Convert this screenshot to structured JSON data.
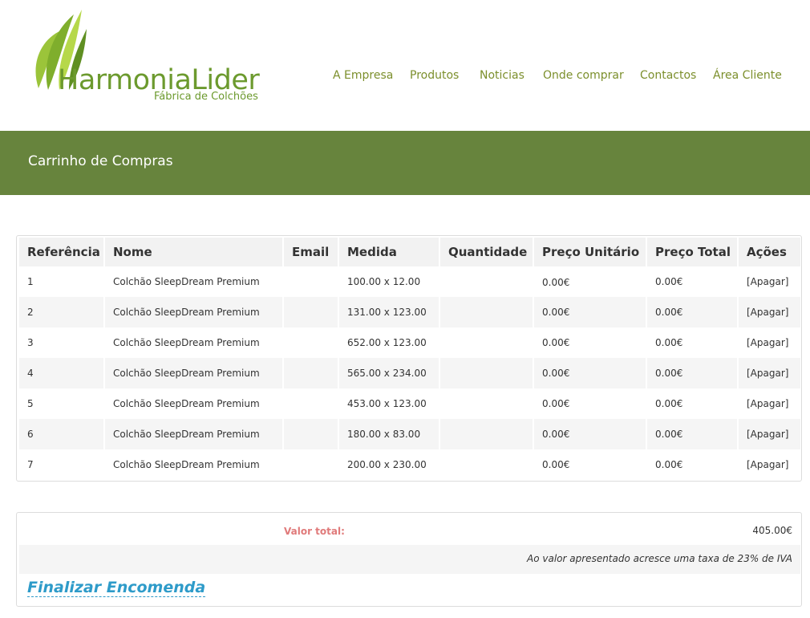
{
  "brand": {
    "name": "HarmoniaLider",
    "tagline": "Fábrica de Colchões",
    "color": "#6c9a2e"
  },
  "nav": [
    {
      "label": "A Empresa"
    },
    {
      "label": "Produtos"
    },
    {
      "label": "Noticias"
    },
    {
      "label": "Onde comprar"
    },
    {
      "label": "Contactos"
    },
    {
      "label": "Área Cliente"
    }
  ],
  "page": {
    "title": "Carrinho de Compras",
    "title_bar_color": "#67843d"
  },
  "cart": {
    "columns": [
      "Referência",
      "Nome",
      "Email",
      "Medida",
      "Quantidade",
      "Preço Unitário",
      "Preço Total",
      "Ações"
    ],
    "rows": [
      {
        "ref": "1",
        "nome": "Colchão SleepDream Premium",
        "email": "",
        "medida": "100.00 x 12.00",
        "quantidade": "",
        "preco_unit": "0.00€",
        "preco_total": "0.00€",
        "acao": "[Apagar]"
      },
      {
        "ref": "2",
        "nome": "Colchão SleepDream Premium",
        "email": "",
        "medida": "131.00 x 123.00",
        "quantidade": "",
        "preco_unit": "0.00€",
        "preco_total": "0.00€",
        "acao": "[Apagar]"
      },
      {
        "ref": "3",
        "nome": "Colchão SleepDream Premium",
        "email": "",
        "medida": "652.00 x 123.00",
        "quantidade": "",
        "preco_unit": "0.00€",
        "preco_total": "0.00€",
        "acao": "[Apagar]"
      },
      {
        "ref": "4",
        "nome": "Colchão SleepDream Premium",
        "email": "",
        "medida": "565.00 x 234.00",
        "quantidade": "",
        "preco_unit": "0.00€",
        "preco_total": "0.00€",
        "acao": "[Apagar]"
      },
      {
        "ref": "5",
        "nome": "Colchão SleepDream Premium",
        "email": "",
        "medida": "453.00 x 123.00",
        "quantidade": "",
        "preco_unit": "0.00€",
        "preco_total": "0.00€",
        "acao": "[Apagar]"
      },
      {
        "ref": "6",
        "nome": "Colchão SleepDream Premium",
        "email": "",
        "medida": "180.00 x 83.00",
        "quantidade": "",
        "preco_unit": "0.00€",
        "preco_total": "0.00€",
        "acao": "[Apagar]"
      },
      {
        "ref": "7",
        "nome": "Colchão SleepDream Premium",
        "email": "",
        "medida": "200.00 x 230.00",
        "quantidade": "",
        "preco_unit": "0.00€",
        "preco_total": "0.00€",
        "acao": "[Apagar]"
      }
    ]
  },
  "summary": {
    "total_label": "Valor total:",
    "total_value": "405.00€",
    "iva_note": "Ao valor apresentado acresce uma taxa de 23% de IVA",
    "finalize_label": "Finalizar Encomenda"
  }
}
